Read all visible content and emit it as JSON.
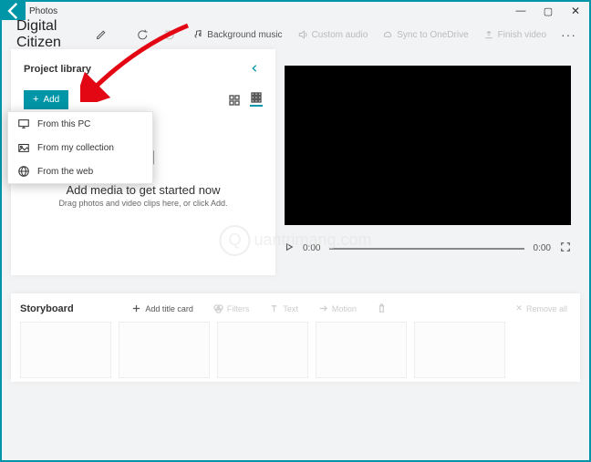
{
  "window": {
    "title": "Photos"
  },
  "toolbar": {
    "project_name": "Digital Citizen",
    "bg_music": "Background music",
    "custom_audio": "Custom audio",
    "sync": "Sync to OneDrive",
    "finish": "Finish video"
  },
  "library": {
    "title": "Project library",
    "add_label": "Add",
    "menu": [
      "From this PC",
      "From my collection",
      "From the web"
    ],
    "empty_title": "Add media to get started now",
    "empty_sub": "Drag photos and video clips here, or click Add."
  },
  "player": {
    "current": "0:00",
    "total": "0:00"
  },
  "storyboard": {
    "title": "Storyboard",
    "add_title": "Add title card",
    "filters": "Filters",
    "text": "Text",
    "motion": "Motion",
    "remove_all": "Remove all"
  },
  "watermark": {
    "text": "uantrimang.com"
  }
}
